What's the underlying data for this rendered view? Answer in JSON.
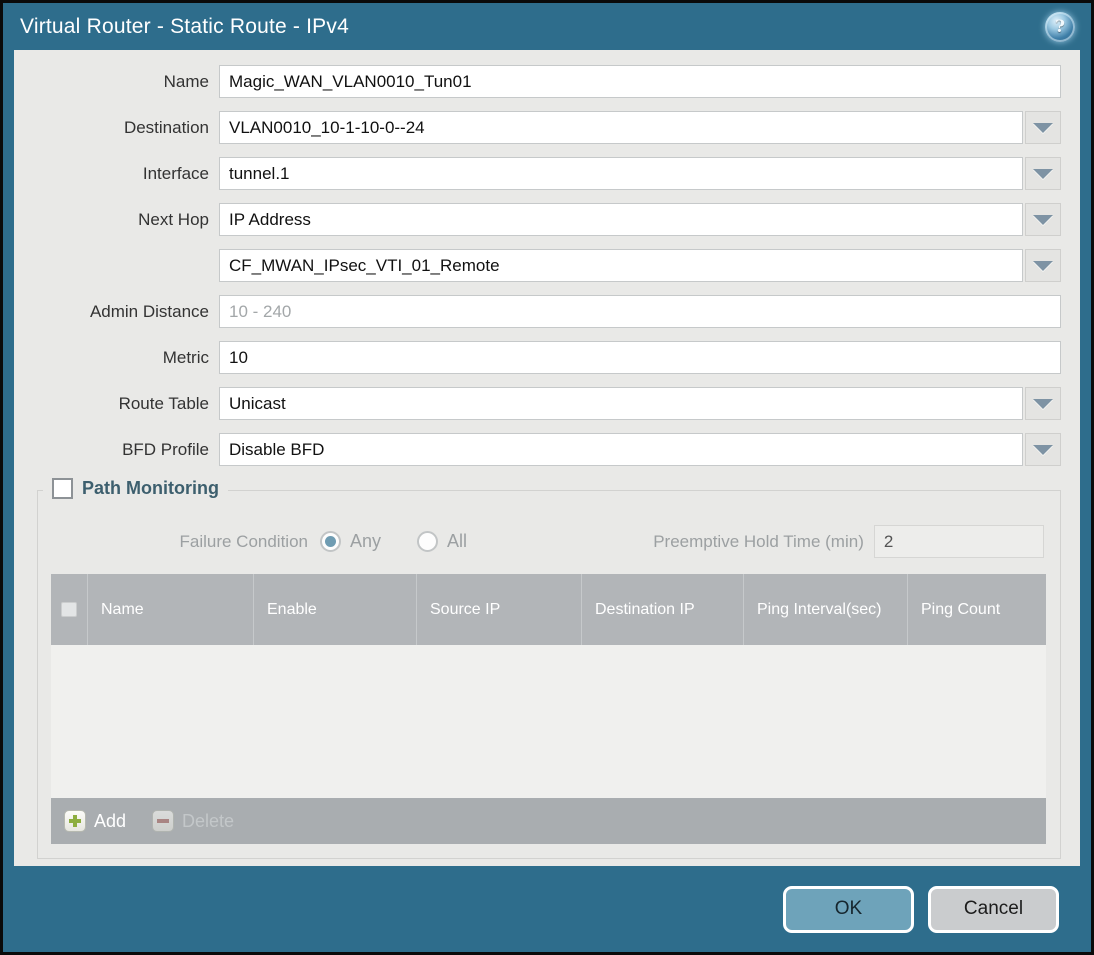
{
  "window": {
    "title": "Virtual Router - Static Route - IPv4",
    "help_glyph": "?"
  },
  "form": {
    "name": {
      "label": "Name",
      "value": "Magic_WAN_VLAN0010_Tun01"
    },
    "destination": {
      "label": "Destination",
      "value": "VLAN0010_10-1-10-0--24"
    },
    "interface": {
      "label": "Interface",
      "value": "tunnel.1"
    },
    "next_hop": {
      "label": "Next Hop",
      "value": "IP Address"
    },
    "next_hop_address": {
      "value": "CF_MWAN_IPsec_VTI_01_Remote"
    },
    "admin_distance": {
      "label": "Admin Distance",
      "placeholder": "10 - 240"
    },
    "metric": {
      "label": "Metric",
      "value": "10"
    },
    "route_table": {
      "label": "Route Table",
      "value": "Unicast"
    },
    "bfd_profile": {
      "label": "BFD Profile",
      "value": "Disable BFD"
    }
  },
  "path_monitoring": {
    "title": "Path Monitoring",
    "failure_condition_label": "Failure Condition",
    "radio_any_label": "Any",
    "radio_all_label": "All",
    "selected_failure_condition": "Any",
    "hold_time_label": "Preemptive Hold Time (min)",
    "hold_time_value": "2",
    "table": {
      "columns": [
        "Name",
        "Enable",
        "Source IP",
        "Destination IP",
        "Ping Interval(sec)",
        "Ping Count"
      ],
      "rows": []
    },
    "add_label": "Add",
    "delete_label": "Delete"
  },
  "footer": {
    "ok_label": "OK",
    "cancel_label": "Cancel"
  },
  "colors": {
    "titlebar": "#2e6d8c",
    "content_bg": "#e9e9e7",
    "accent_ok": "#6ea3ba",
    "table_header": "#b2b5b8",
    "table_footer": "#a9adb0",
    "pm_title": "#3d5f6e",
    "add_green": "#8dae3f",
    "delete_red": "#a96b66"
  }
}
